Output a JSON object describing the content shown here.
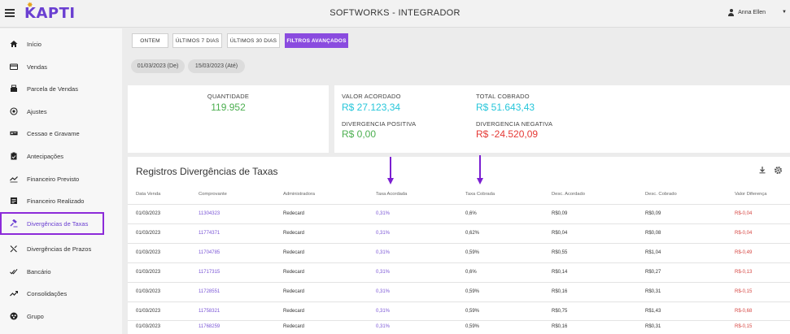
{
  "header": {
    "title": "SOFTWORKS - INTEGRADOR",
    "logo_text": "KAPTI",
    "user_name": "Anna Ellen"
  },
  "sidebar": {
    "items": [
      {
        "label": "Início",
        "icon": "home-icon"
      },
      {
        "label": "Vendas",
        "icon": "credit-card-icon"
      },
      {
        "label": "Parcela de Vendas",
        "icon": "register-icon"
      },
      {
        "label": "Ajustes",
        "icon": "circle-target-icon"
      },
      {
        "label": "Cessao e Gravame",
        "icon": "card-list-icon"
      },
      {
        "label": "Antecipações",
        "icon": "clipboard-icon"
      },
      {
        "label": "Financeiro Previsto",
        "icon": "chart-trend-icon"
      },
      {
        "label": "Financeiro Realizado",
        "icon": "document-icon"
      },
      {
        "label": "Divergências de Taxas",
        "icon": "gavel-icon",
        "active": true
      },
      {
        "label": "Divergências de Prazos",
        "icon": "shuffle-icon"
      },
      {
        "label": "Bancário",
        "icon": "check-double-icon"
      },
      {
        "label": "Consolidações",
        "icon": "trending-up-icon"
      },
      {
        "label": "Grupo",
        "icon": "group-icon"
      }
    ]
  },
  "filters": {
    "buttons": [
      "ONTEM",
      "ÚLTIMOS 7 DIAS",
      "ÚLTIMOS 30 DIAS",
      "FILTROS AVANÇADOS"
    ],
    "date_from": "01/03/2023 (De)",
    "date_to": "15/03/2023 (Até)"
  },
  "summary": {
    "quantidade_label": "QUANTIDADE",
    "quantidade_value": "119.952",
    "valor_acordado_label": "VALOR ACORDADO",
    "valor_acordado_value": "R$ 27.123,34",
    "total_cobrado_label": "TOTAL COBRADO",
    "total_cobrado_value": "R$ 51.643,43",
    "div_positiva_label": "DIVERGENCIA POSITIVA",
    "div_positiva_value": "R$ 0,00",
    "div_negativa_label": "DIVERGENCIA NEGATIVA",
    "div_negativa_value": "R$ -24.520,09"
  },
  "table": {
    "title": "Registros Divergências de Taxas",
    "headers": [
      "Data Venda",
      "Comprovante",
      "Administradora",
      "Taxa Acordada",
      "Taxa Cobrada",
      "Desc. Acordado",
      "Desc. Cobrado",
      "Valor Diferença"
    ],
    "rows": [
      [
        "01/03/2023",
        "11304323",
        "Redecard",
        "0,31%",
        "0,6%",
        "R$0,09",
        "R$0,09",
        "R$-0,04"
      ],
      [
        "01/03/2023",
        "11774371",
        "Redecard",
        "0,31%",
        "0,62%",
        "R$0,04",
        "R$0,08",
        "R$-0,04"
      ],
      [
        "01/03/2023",
        "11704785",
        "Redecard",
        "0,31%",
        "0,59%",
        "R$0,55",
        "R$1,04",
        "R$-0,49"
      ],
      [
        "01/03/2023",
        "11717315",
        "Redecard",
        "0,31%",
        "0,6%",
        "R$0,14",
        "R$0,27",
        "R$-0,13"
      ],
      [
        "01/03/2023",
        "11728551",
        "Redecard",
        "0,31%",
        "0,59%",
        "R$0,16",
        "R$0,31",
        "R$-0,15"
      ],
      [
        "01/03/2023",
        "11758321",
        "Redecard",
        "0,31%",
        "0,59%",
        "R$0,75",
        "R$1,43",
        "R$-0,68"
      ],
      [
        "01/03/2023",
        "11768259",
        "Redecard",
        "0,31%",
        "0,59%",
        "R$0,16",
        "R$0,31",
        "R$-0,15"
      ]
    ]
  },
  "colors": {
    "accent": "#8a4bdf",
    "green": "#4caf50",
    "cyan": "#26c6da",
    "red": "#e53935",
    "arrow": "#7b1fd1"
  }
}
